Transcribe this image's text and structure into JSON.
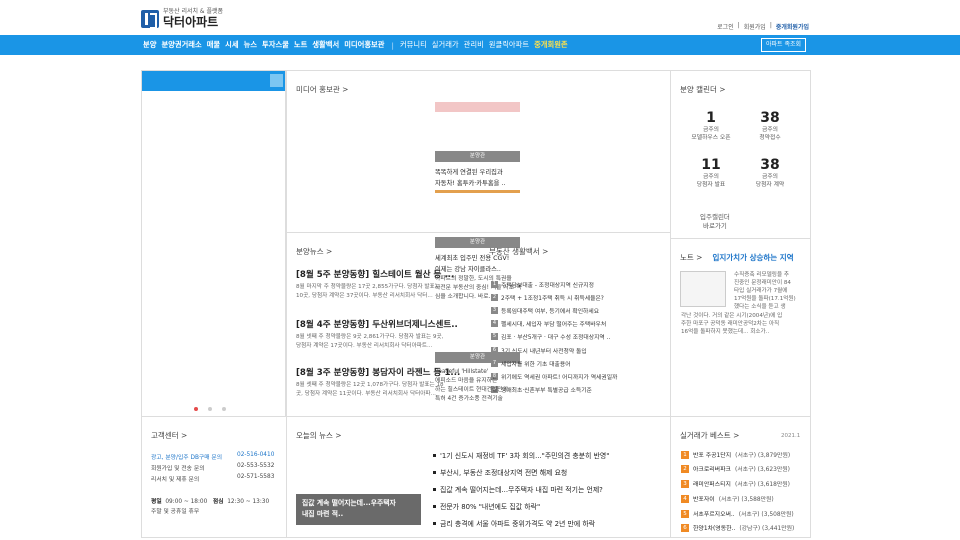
{
  "header": {
    "logo_sub": "부동산 리서치 & 플랫폼",
    "logo_name": "닥터아파트",
    "util": [
      "로그인",
      "회원가입",
      "중개회원가입"
    ]
  },
  "nav": {
    "items": [
      "분양",
      "분양권거래소",
      "매물",
      "시세",
      "뉴스",
      "투자스쿨",
      "노트",
      "생활백서",
      "미디어홍보관"
    ],
    "separator": "|",
    "items2": [
      "커뮤니티",
      "실거래가",
      "관리비",
      "원클릭아파트"
    ],
    "highlight": "중개회원존",
    "button": "아파트 족조회"
  },
  "media": {
    "title": "미디어 홍보관 >",
    "badge1": "분양관",
    "caption1": [
      "똑똑하게 연결된 우리집과",
      "자동차! 홈투카·카투홈을 .."
    ],
    "badge2": "분양관",
    "caption2": [
      "세계최초 입주민 전용 CGV!",
      "이제는 강남 자이클라스.."
    ],
    "badge3": "분양관",
    "caption3": [
      "Peaceful 'Hillstate'",
      "에피소드 마음을 유지하는",
      "하는 힐스테이트 현대건설만의",
      "특허 4건 증가소풍 전격기술"
    ]
  },
  "news": {
    "title": "분양뉴스 >",
    "items": [
      {
        "headline": "[8월 5주 분양동향] 힐스테이트 월산 등 ...",
        "body": [
          "8월 마지막 주 청약물량은 17곳 2,855가구다. 당첨자 발표는",
          "10곳, 당첨자 계약은 37곳이다. 부동산 리서치회사 닥터..."
        ]
      },
      {
        "headline": "[8월 4주 분양동향] 두산위브더제니스센트..",
        "body": [
          "8월 넷째 주 청약물량은 9곳 2,861가구다. 당첨자 발표는 9곳,",
          "당첨자 계약은 17곳이다. 부동산 리서치회사 닥터아파트..."
        ]
      },
      {
        "headline": "[8월 3주 분양동향] 봉담자이 라젠느 등 1...",
        "body": [
          "8월 셋째 주 청약물량은 12곳 1,078가구다. 당첨자 발표는 18",
          "곳, 당첨자 계약은 11곳이다. 부동산 리서치회사 닥터아파..."
        ]
      }
    ]
  },
  "life": {
    "title": "부동산 생활백서 >",
    "overlay": [
      "아파트의 정말한, 도시의 특권을",
      "사전문 부동산의 중심! 서울 서초 핵",
      "심을 소개합니다. 바로.."
    ],
    "items": [
      {
        "n": "1",
        "text": "주택담보대출 - 조정대상지역 신규지정"
      },
      {
        "n": "2",
        "text": "2주택 + 1조정1주택 취득 시 취득세율은?"
      },
      {
        "n": "3",
        "text": "등록임대주택 여부, 등기에서 확인하세요"
      },
      {
        "n": "4",
        "text": "펠세시대, 세입자 부담 떨어주는 주택바우처"
      },
      {
        "n": "5",
        "text": "김포 · 부산5개구 · 대구 수성 조정대상지역 .."
      },
      {
        "n": "6",
        "text": "3기 신도시 내년부터 사전청약 돌입"
      },
      {
        "n": "7",
        "text": "세입자를 위한 기초 대출용어"
      },
      {
        "n": "8",
        "text": "위기에도 역세권 아파트! 어디까지가 역세권일까"
      },
      {
        "n": "9",
        "text": "생애최초·신혼부부 특별공급 소득기준"
      }
    ]
  },
  "calendar": {
    "title": "분양 캘린더 >",
    "cells": [
      {
        "num": "1",
        "label": [
          "금주의",
          "모델하우스 오픈"
        ]
      },
      {
        "num": "38",
        "label": [
          "금주의",
          "청약접수"
        ]
      },
      {
        "num": "11",
        "label": [
          "금주의",
          "당첨자 발표"
        ]
      },
      {
        "num": "38",
        "label": [
          "금주의",
          "당첨자 계약"
        ]
      }
    ],
    "link": [
      "입주캘린더",
      "바로가기"
    ]
  },
  "note": {
    "title": "노트 >",
    "headline": "입지가치가 상승하는 지역",
    "body": [
      "수직증축 리모델링을 추",
      "진중인 문정래미안이 84",
      "타입 실거래가가 7월에",
      "17억원을 돌파(17.1억원)",
      "했다는 소식을 듣고 생",
      "각난 것이다. 거의 같은 시기(2004년)에 입",
      "주한 마포구 공덕동 래미안공덕2차는 아직",
      "16억을 돌파하지 못했는데... 회소가.."
    ]
  },
  "customer": {
    "title": "고객센터 >",
    "rows": [
      {
        "label": "광고, 분양/입주 DB구매 문의",
        "value": "02-516-0410",
        "blue": true
      },
      {
        "label": "회원가입 및 전송 문의",
        "value": "02-553-5532",
        "blue": false
      },
      {
        "label": "리서치 및 제휴 문의",
        "value": "02-571-5583",
        "blue": false
      }
    ],
    "hours_label": "평일",
    "hours": "09:00 ~ 18:00",
    "lunch_label": "점심",
    "lunch": "12:30 ~ 13:30",
    "closed": "주말 및 공휴일 휴무"
  },
  "today": {
    "title": "오늘의 뉴스 >",
    "box": [
      "집값 계속 떨어지는데...우주택자",
      "내집 마련 적.."
    ],
    "items": [
      "'1기 신도시 재정비 TF' 3차 회의...\"주민의견 충분히 반영\"",
      "부산시, 부동산 조정대상지역 전면 해제 요청",
      "집값 계속 떨어지는데...무주택자 내집 마련 적기는 언제?",
      "전문가 80% \"내년에도 집값 하락\"",
      "금리 충격에 서울 아파트 중위가격도 약 2년 만에 하락"
    ]
  },
  "best": {
    "title": "실거래가 베스트 >",
    "date": "2021.1",
    "items": [
      {
        "rank": "1",
        "name": "반포 주공1단지",
        "sub": "(서초구) (3,879만원)"
      },
      {
        "rank": "2",
        "name": "아크로리버파크",
        "sub": "(서초구) (3,623만원)"
      },
      {
        "rank": "3",
        "name": "래미안퍼스티지",
        "sub": "(서초구) (3,618만원)"
      },
      {
        "rank": "4",
        "name": "반포자이",
        "sub": "(서초구) (3,588만원)"
      },
      {
        "rank": "5",
        "name": "서초푸르지오써..",
        "sub": "(서초구) (3,508만원)"
      },
      {
        "rank": "6",
        "name": "한양1차(영동한..",
        "sub": "(강남구) (3,441만원)"
      }
    ]
  }
}
